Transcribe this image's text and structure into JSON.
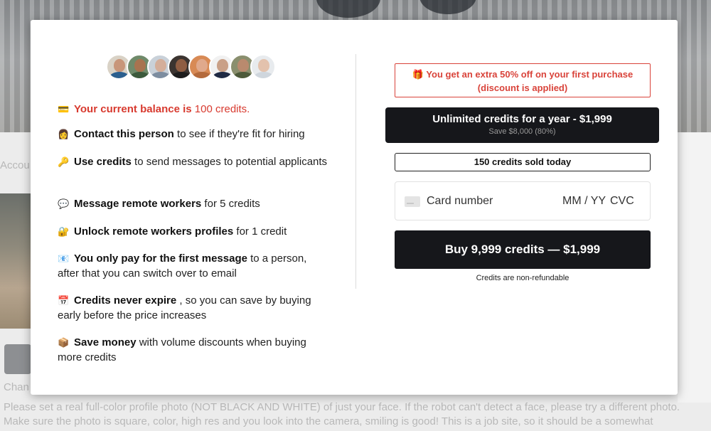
{
  "background": {
    "left_label": "Accou",
    "change_label": "Chan",
    "photo_instructions_line1": "Please set a real full-color profile photo (NOT BLACK AND WHITE) of just your face. If the robot can't detect a face, please try a different photo.",
    "photo_instructions_line2": "Make sure the photo is square, color, high res and you look into the camera, smiling is good! This is a job site, so it should be a somewhat"
  },
  "modal": {
    "avatars": [
      {
        "name": "avatar-1",
        "skin": "#c8967a",
        "shirt": "#2b5f8e",
        "bg": "#d9d2c6"
      },
      {
        "name": "avatar-2",
        "skin": "#a8734f",
        "shirt": "#3c5a3c",
        "bg": "#6f8a6a"
      },
      {
        "name": "avatar-3",
        "skin": "#d4ae9a",
        "shirt": "#7d8da0",
        "bg": "#c9d1d9"
      },
      {
        "name": "avatar-4",
        "skin": "#8f5d42",
        "shirt": "#1d1d1d",
        "bg": "#3b3430"
      },
      {
        "name": "avatar-5",
        "skin": "#e0a98c",
        "shirt": "#b46a3c",
        "bg": "#d88a55"
      },
      {
        "name": "avatar-6",
        "skin": "#c9a087",
        "shirt": "#1f2a44",
        "bg": "#f1f1f1"
      },
      {
        "name": "avatar-7",
        "skin": "#b98a6e",
        "shirt": "#4d5a3a",
        "bg": "#8a8f6e"
      },
      {
        "name": "avatar-8",
        "skin": "#e3c2ad",
        "shirt": "#cfd6dd",
        "bg": "#e8ebee"
      }
    ],
    "features": {
      "balance": {
        "emoji": "💳",
        "bold": "Your current balance is",
        "value": "100 credits."
      },
      "contact": {
        "emoji": "👩",
        "bold": "Contact this person",
        "rest": " to see if they're fit for hiring"
      },
      "use": {
        "emoji": "🔑",
        "bold": "Use credits",
        "rest": " to send messages to potential applicants"
      },
      "message": {
        "emoji": "💬",
        "bold": "Message remote workers",
        "rest": " for 5 credits"
      },
      "unlock": {
        "emoji": "🔐",
        "bold": "Unlock remote workers profiles",
        "rest": " for 1 credit"
      },
      "pay": {
        "emoji": "📧",
        "bold": "You only pay for the first message",
        "rest": " to a person, after that you can switch over to email"
      },
      "expire": {
        "emoji": "📅",
        "bold": "Credits never expire",
        "rest": " , so you can save by buying early before the price increases"
      },
      "save": {
        "emoji": "📦",
        "bold": "Save money",
        "rest": " with volume discounts when buying more credits"
      }
    },
    "promo": {
      "icon": "gift-icon",
      "icon_glyph": "🎁",
      "line1": " You get an extra 50% off on your first purchase",
      "line2": "(discount is applied)"
    },
    "unlimited": {
      "title": "Unlimited credits for a year - $1,999",
      "subtitle": "Save $8,000 (80%)"
    },
    "sold_today": "150 credits sold today",
    "card": {
      "number_placeholder": "Card number",
      "expiry_placeholder": "MM / YY",
      "cvc_placeholder": "CVC"
    },
    "buy_button": "Buy 9,999 credits — $1,999",
    "non_refundable": "Credits are non-refundable"
  },
  "colors": {
    "accent_red": "#d83a2f",
    "button_dark": "#16171b"
  }
}
